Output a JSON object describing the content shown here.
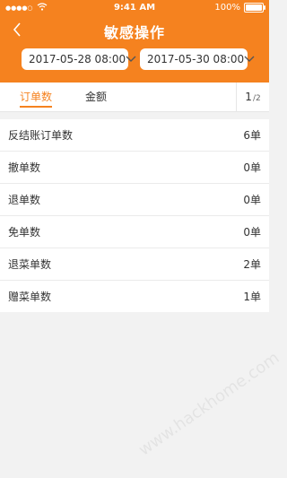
{
  "status": {
    "carrier_dots": "●●●●○",
    "time": "9:41 AM",
    "battery": "100%"
  },
  "nav": {
    "title": "敏感操作"
  },
  "dates": {
    "start": "2017-05-28  08:00",
    "end": "2017-05-30  08:00"
  },
  "tabs": [
    {
      "label": "订单数"
    },
    {
      "label": "金额"
    }
  ],
  "pager": {
    "current": "1",
    "total": "/2"
  },
  "rows": [
    {
      "label": "反结账订单数",
      "value": "6单"
    },
    {
      "label": "撤单数",
      "value": "0单"
    },
    {
      "label": "退单数",
      "value": "0单"
    },
    {
      "label": "免单数",
      "value": "0单"
    },
    {
      "label": "退菜单数",
      "value": "2单"
    },
    {
      "label": "赠菜单数",
      "value": "1单"
    }
  ],
  "watermark": "www.hackhome.com",
  "colors": {
    "accent": "#f5821f"
  }
}
